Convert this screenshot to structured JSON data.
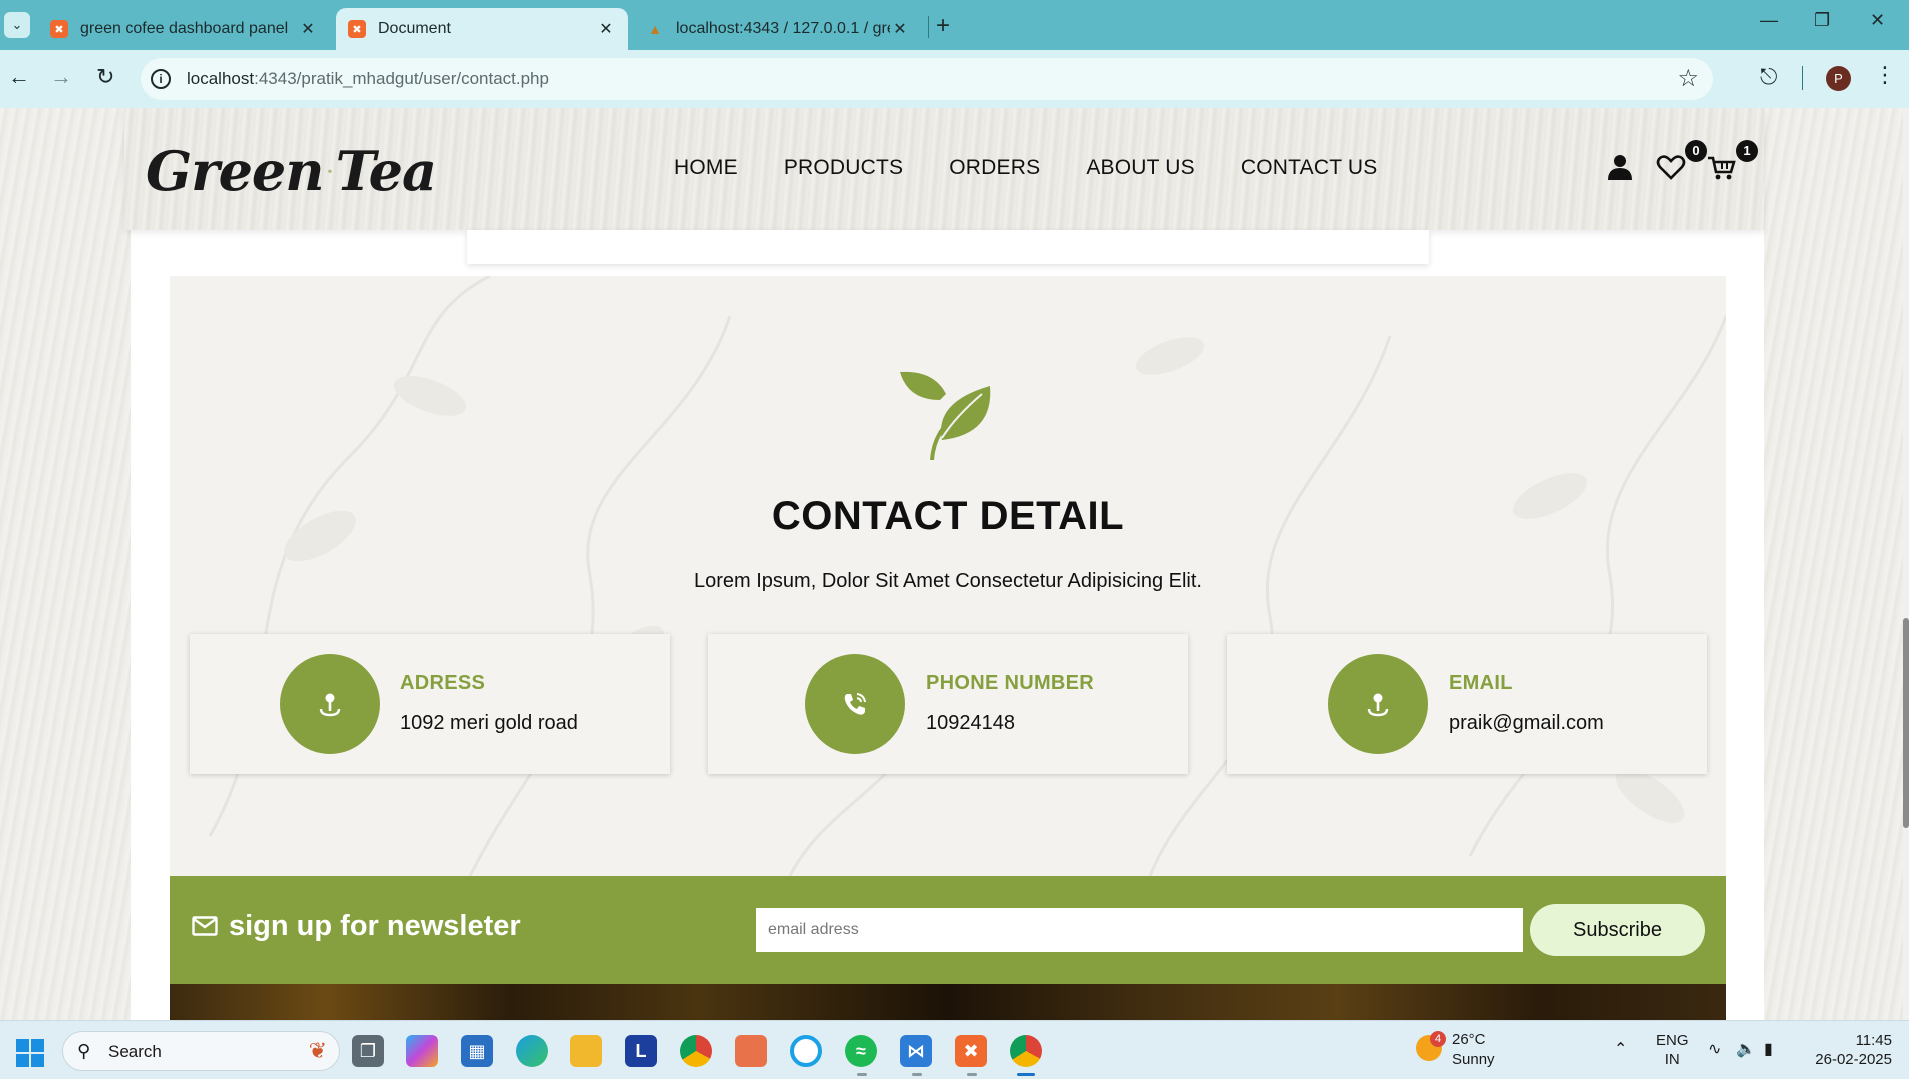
{
  "browser": {
    "tabs": [
      {
        "title": "green cofee dashboard panel",
        "active": false,
        "favicon": "xampp-icon"
      },
      {
        "title": "Document",
        "active": true,
        "favicon": "xampp-icon"
      },
      {
        "title": "localhost:4343 / 127.0.0.1 / gre",
        "active": false,
        "favicon": "phpmyadmin-icon"
      }
    ],
    "url_host": "localhost",
    "url_rest": ":4343/pratik_mhadgut/user/contact.php",
    "profile_initial": "P"
  },
  "site": {
    "logo_left": "Green",
    "logo_right": "Tea",
    "nav": [
      "HOME",
      "PRODUCTS",
      "ORDERS",
      "ABOUT US",
      "CONTACT US"
    ],
    "wishlist_count": "0",
    "cart_count": "1"
  },
  "contact": {
    "title": "CONTACT DETAIL",
    "subtitle": "Lorem Ipsum, Dolor Sit Amet Consectetur Adipisicing Elit.",
    "cards": [
      {
        "title": "ADRESS",
        "value": "1092 meri gold road",
        "icon": "map-pin-icon"
      },
      {
        "title": "PHONE NUMBER",
        "value": "10924148",
        "icon": "phone-icon"
      },
      {
        "title": "EMAIL",
        "value": "praik@gmail.com",
        "icon": "map-pin-icon"
      }
    ]
  },
  "newsletter": {
    "title": "sign up for newsleter",
    "placeholder": "email adress",
    "button": "Subscribe"
  },
  "taskbar": {
    "search": "Search",
    "weather_temp": "26°C",
    "weather_cond": "Sunny",
    "weather_badge": "4",
    "lang_1": "ENG",
    "lang_2": "IN",
    "time": "11:45",
    "date": "26-02-2025"
  },
  "colors": {
    "accent_green": "#86a03f",
    "tab_bar": "#5cb9c5",
    "toolbar": "#d7f1f4"
  }
}
